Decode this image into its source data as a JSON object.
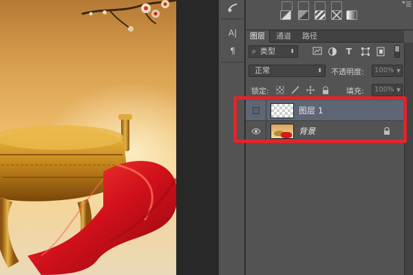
{
  "panel": {
    "tabs": [
      {
        "label": "图层"
      },
      {
        "label": "通道"
      },
      {
        "label": "路径"
      }
    ],
    "filter": {
      "kind_label": "类型"
    },
    "blend": {
      "mode": "正常",
      "opacity_label": "不透明度:",
      "opacity_value": "100%"
    },
    "lock": {
      "label": "锁定:",
      "fill_label": "填充:",
      "fill_value": "100%"
    }
  },
  "layers": [
    {
      "name": "图层 1",
      "visible": false,
      "selected": true,
      "thumbnail": "transparent-checker"
    },
    {
      "name": "背景",
      "visible": true,
      "selected": false,
      "locked": true,
      "thumbnail": "background-image"
    }
  ],
  "tools": [
    {
      "icon": "character-panel-icon",
      "glyph": "A|"
    },
    {
      "icon": "paragraph-panel-icon",
      "glyph": "¶"
    }
  ],
  "colors": {
    "highlight": "#e2242b",
    "selected_layer": "#5e6675",
    "panel_bg": "#535353"
  }
}
